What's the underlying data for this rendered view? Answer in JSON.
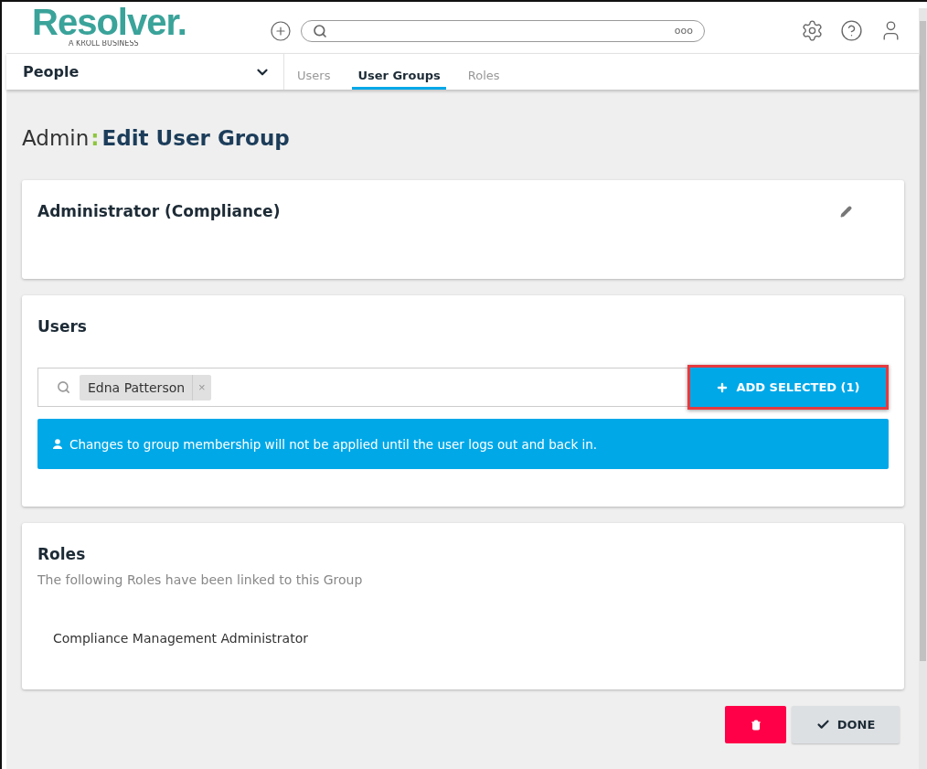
{
  "header": {
    "logo": "Resolver.",
    "logo_subtitle": "A KROLL BUSINESS",
    "search": {
      "more": "ooo"
    }
  },
  "nav": {
    "section": "People",
    "tabs": [
      {
        "label": "Users",
        "selected": false
      },
      {
        "label": "User Groups",
        "selected": true
      },
      {
        "label": "Roles",
        "selected": false
      }
    ]
  },
  "title": {
    "prefix": "Admin",
    "separator": ":",
    "text": "Edit User Group"
  },
  "group_card": {
    "name": "Administrator (Compliance)"
  },
  "users_card": {
    "heading": "Users",
    "tags": [
      "Edna Patterson"
    ],
    "tag_remove": "×",
    "add_button": {
      "label": "ADD SELECTED (1)",
      "highlighted": true
    },
    "notice": "Changes to group membership will not be applied until the user logs out and back in."
  },
  "roles_card": {
    "heading": "Roles",
    "description": "The following Roles have been linked to this Group",
    "roles": [
      "Compliance Management Administrator"
    ]
  },
  "actions": {
    "done": "DONE"
  }
}
